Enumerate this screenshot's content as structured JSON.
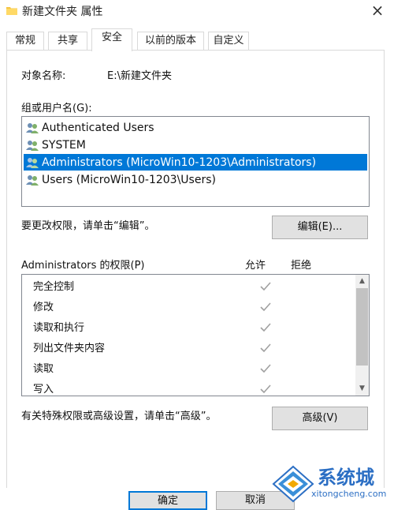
{
  "window": {
    "title": "新建文件夹 属性",
    "close_glyph": "×"
  },
  "tabs": [
    {
      "label": "常规"
    },
    {
      "label": "共享"
    },
    {
      "label": "安全",
      "active": true
    },
    {
      "label": "以前的版本"
    },
    {
      "label": "自定义"
    }
  ],
  "object": {
    "label": "对象名称:",
    "value": "E:\\新建文件夹"
  },
  "users": {
    "label": "组或用户名(G):",
    "items": [
      {
        "name": "Authenticated Users",
        "icon": "users-group-icon"
      },
      {
        "name": "SYSTEM",
        "icon": "users-group-icon"
      },
      {
        "name": "Administrators (MicroWin10-1203\\Administrators)",
        "icon": "users-group-icon",
        "selected": true
      },
      {
        "name": "Users (MicroWin10-1203\\Users)",
        "icon": "users-group-icon"
      }
    ]
  },
  "edit": {
    "hint": "要更改权限，请单击“编辑”。",
    "button": "编辑(E)..."
  },
  "permissions": {
    "label": "Administrators 的权限(P)",
    "col_allow": "允许",
    "col_deny": "拒绝",
    "rows": [
      {
        "name": "完全控制",
        "allow": true,
        "deny": false
      },
      {
        "name": "修改",
        "allow": true,
        "deny": false
      },
      {
        "name": "读取和执行",
        "allow": true,
        "deny": false
      },
      {
        "name": "列出文件夹内容",
        "allow": true,
        "deny": false
      },
      {
        "name": "读取",
        "allow": true,
        "deny": false
      },
      {
        "name": "写入",
        "allow": true,
        "deny": false
      }
    ]
  },
  "advanced": {
    "hint": "有关特殊权限或高级设置，请单击“高级”。",
    "button": "高级(V)"
  },
  "footer": {
    "ok": "确定",
    "cancel": "取消"
  },
  "watermark": {
    "text": "系统城",
    "url": "xitongcheng.com"
  },
  "colors": {
    "selection": "#0078d7",
    "check": "#a0a0a0",
    "watermark": "#2c6fc4"
  }
}
